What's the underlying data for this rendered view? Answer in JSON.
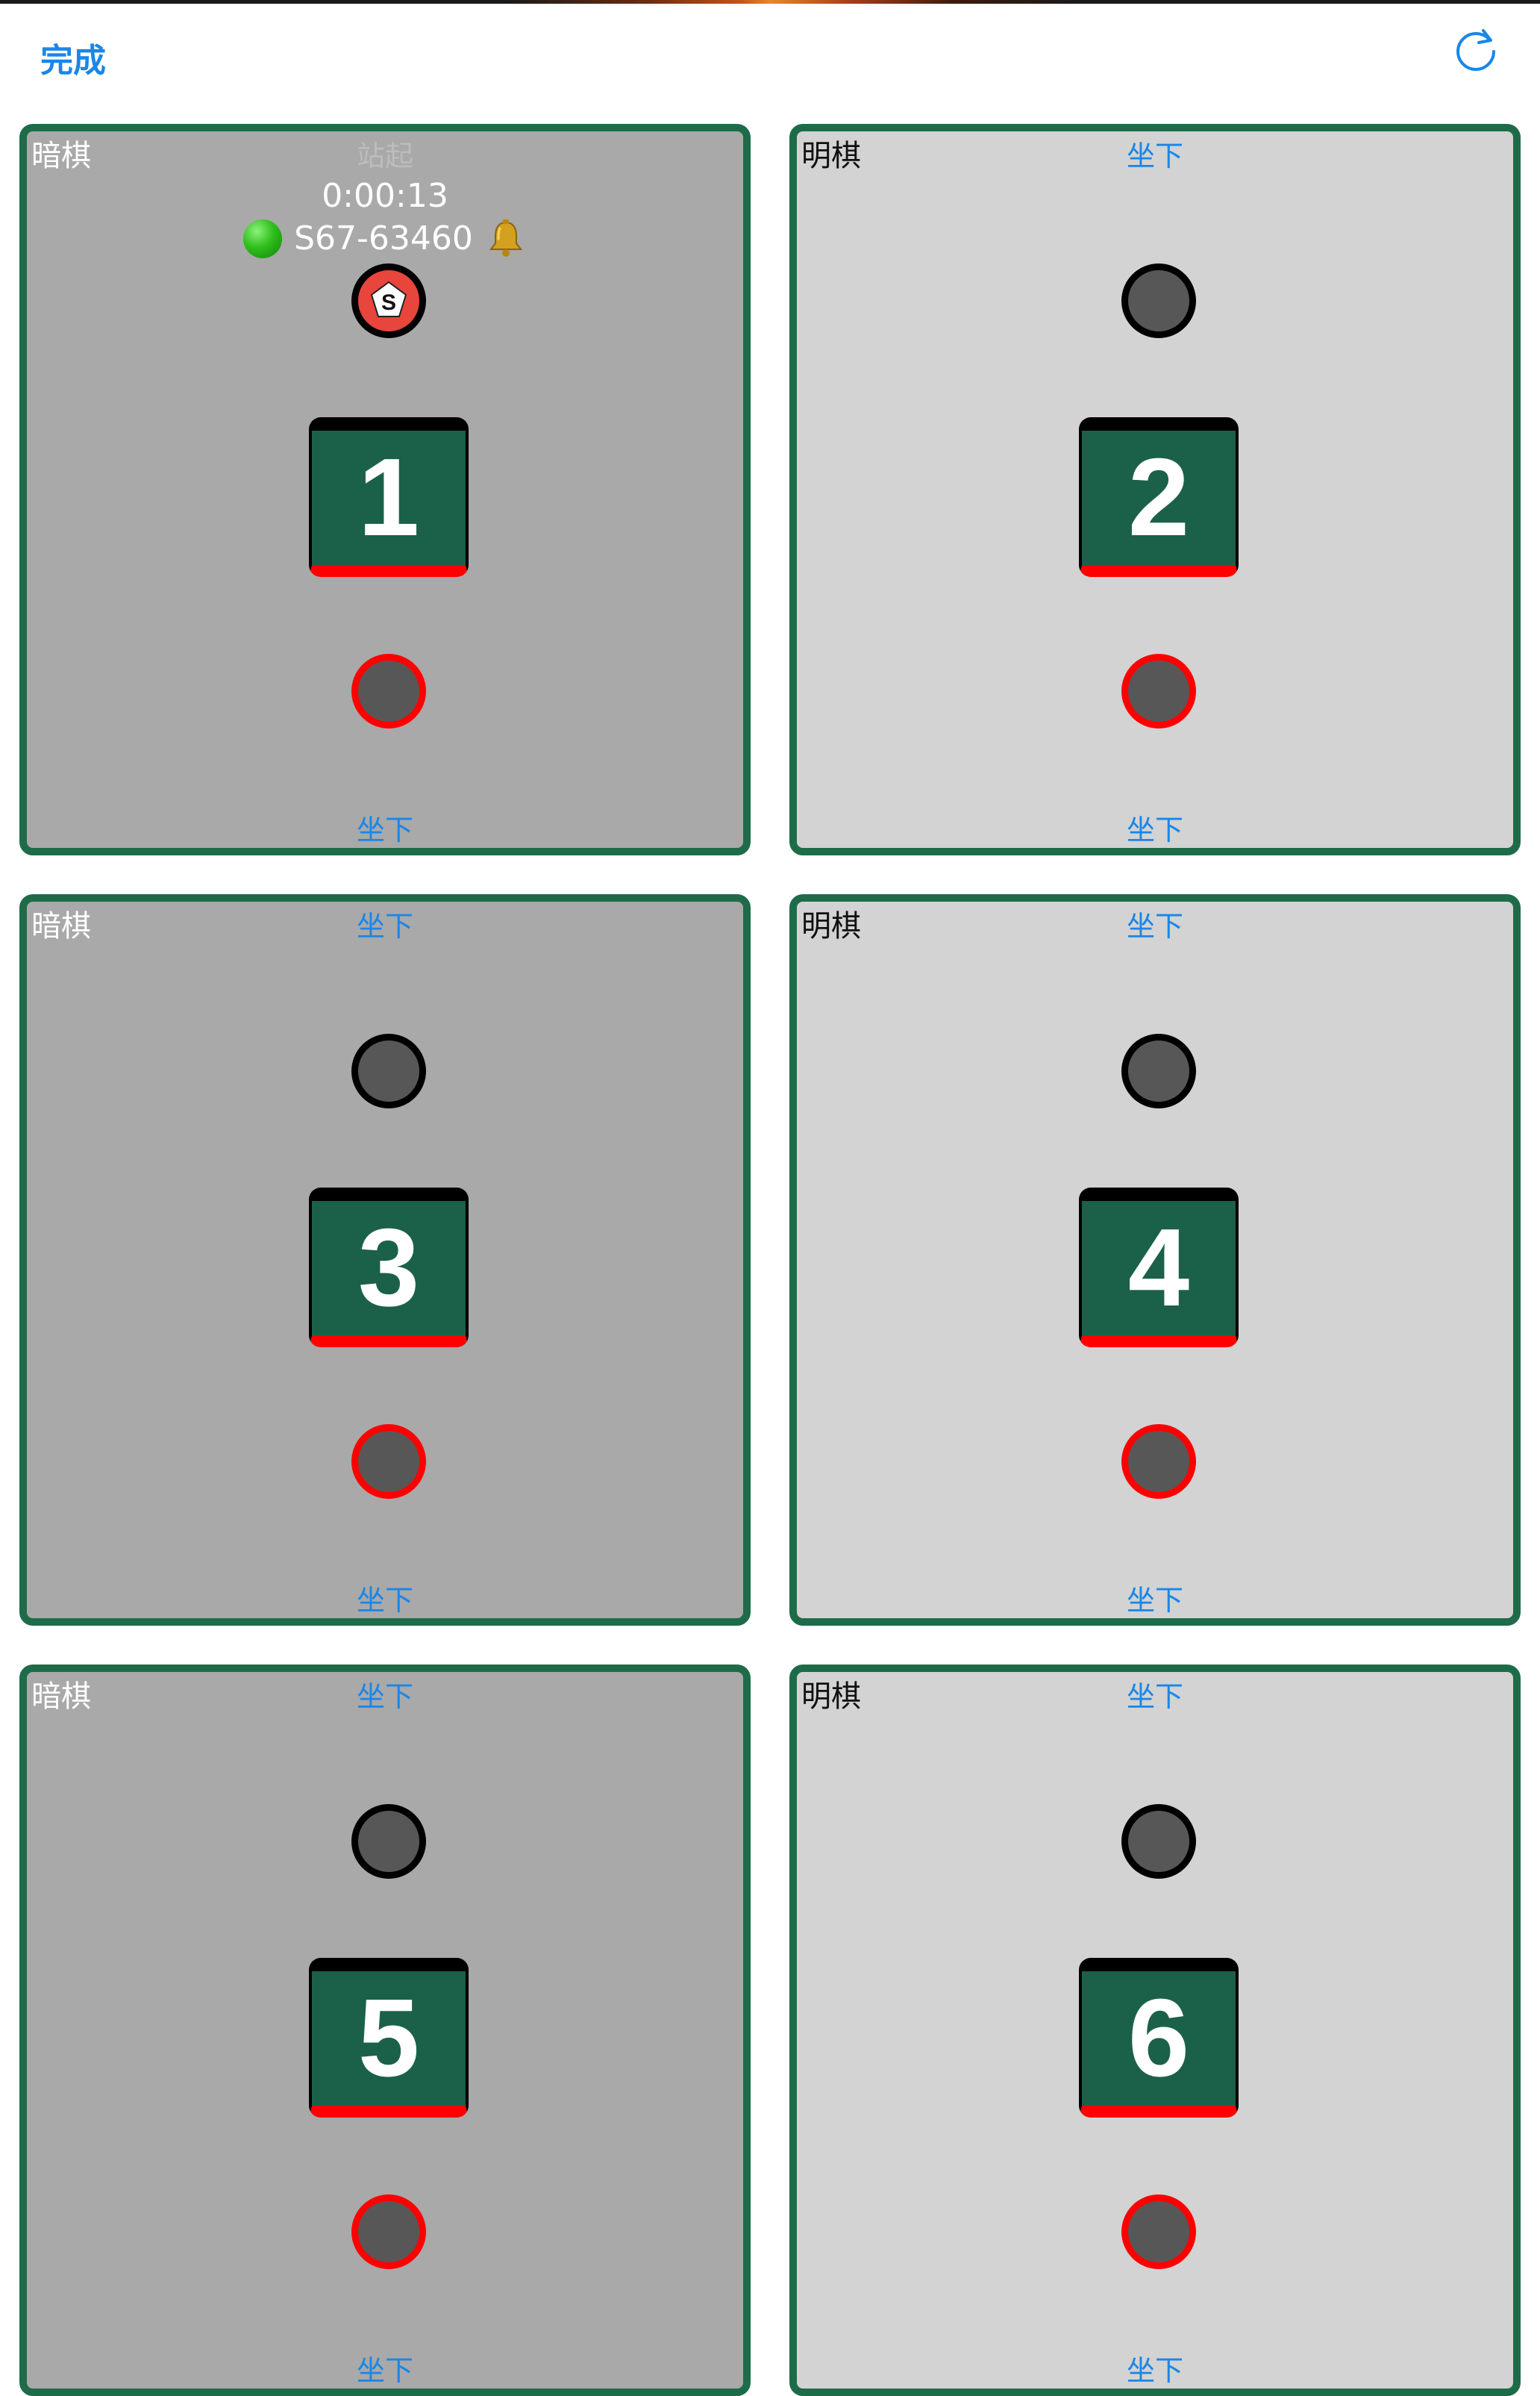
{
  "header": {
    "done_label": "完成",
    "refresh_icon": "refresh-icon",
    "accent_color": "#1a86e8"
  },
  "tables": [
    {
      "number": "1",
      "mode": "暗棋",
      "theme": "dark",
      "top_action": "站起",
      "bottom_action": "坐下",
      "timer": "0:00:13",
      "player": "S67-63460",
      "player_status": "green-dot-icon",
      "player_badge": "bell-icon",
      "upper_seat_icon": "pentagon-s-icon"
    },
    {
      "number": "2",
      "mode": "明棋",
      "theme": "light",
      "top_action": "坐下",
      "bottom_action": "坐下"
    },
    {
      "number": "3",
      "mode": "暗棋",
      "theme": "dark",
      "top_action": "坐下",
      "bottom_action": "坐下"
    },
    {
      "number": "4",
      "mode": "明棋",
      "theme": "light",
      "top_action": "坐下",
      "bottom_action": "坐下"
    },
    {
      "number": "5",
      "mode": "暗棋",
      "theme": "dark",
      "top_action": "坐下",
      "bottom_action": "坐下"
    },
    {
      "number": "6",
      "mode": "明棋",
      "theme": "light",
      "top_action": "坐下",
      "bottom_action": "坐下"
    }
  ],
  "colors": {
    "card_border": "#1e6b4a",
    "table_green": "#1b6149",
    "dark_card_bg": "#a9a9a9",
    "light_card_bg": "#d3d3d3",
    "seat_red_ring": "#ff0000"
  }
}
